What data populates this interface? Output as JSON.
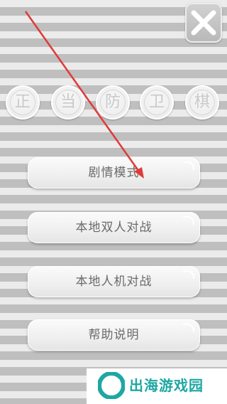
{
  "title_chars": [
    "正",
    "当",
    "防",
    "卫",
    "棋"
  ],
  "menu": {
    "story_mode": "剧情模式",
    "local_pvp": "本地双人对战",
    "local_vs_ai": "本地人机对战",
    "help": "帮助说明"
  },
  "close_icon": "close-x-icon",
  "watermark": {
    "text": "出海游戏园",
    "brand_color": "#1ea7a3"
  },
  "colors": {
    "stripe_light": "#ebebeb",
    "stripe_dark": "#bfbfbf",
    "button_text": "#6a6a6a",
    "arrow": "#e03a3a"
  }
}
